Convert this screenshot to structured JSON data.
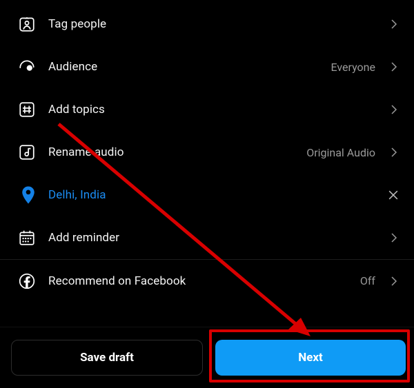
{
  "options": {
    "tag_people": {
      "label": "Tag people"
    },
    "audience": {
      "label": "Audience",
      "value": "Everyone"
    },
    "add_topics": {
      "label": "Add topics"
    },
    "rename_audio": {
      "label": "Rename audio",
      "value": "Original Audio"
    },
    "location": {
      "label": "Delhi, India"
    },
    "add_reminder": {
      "label": "Add reminder"
    },
    "recommend_fb": {
      "label": "Recommend on Facebook",
      "value": "Off"
    }
  },
  "footer": {
    "draft_label": "Save draft",
    "next_label": "Next"
  },
  "annotation": {
    "arrow_color": "#d80000",
    "highlight_color": "#d80000"
  }
}
